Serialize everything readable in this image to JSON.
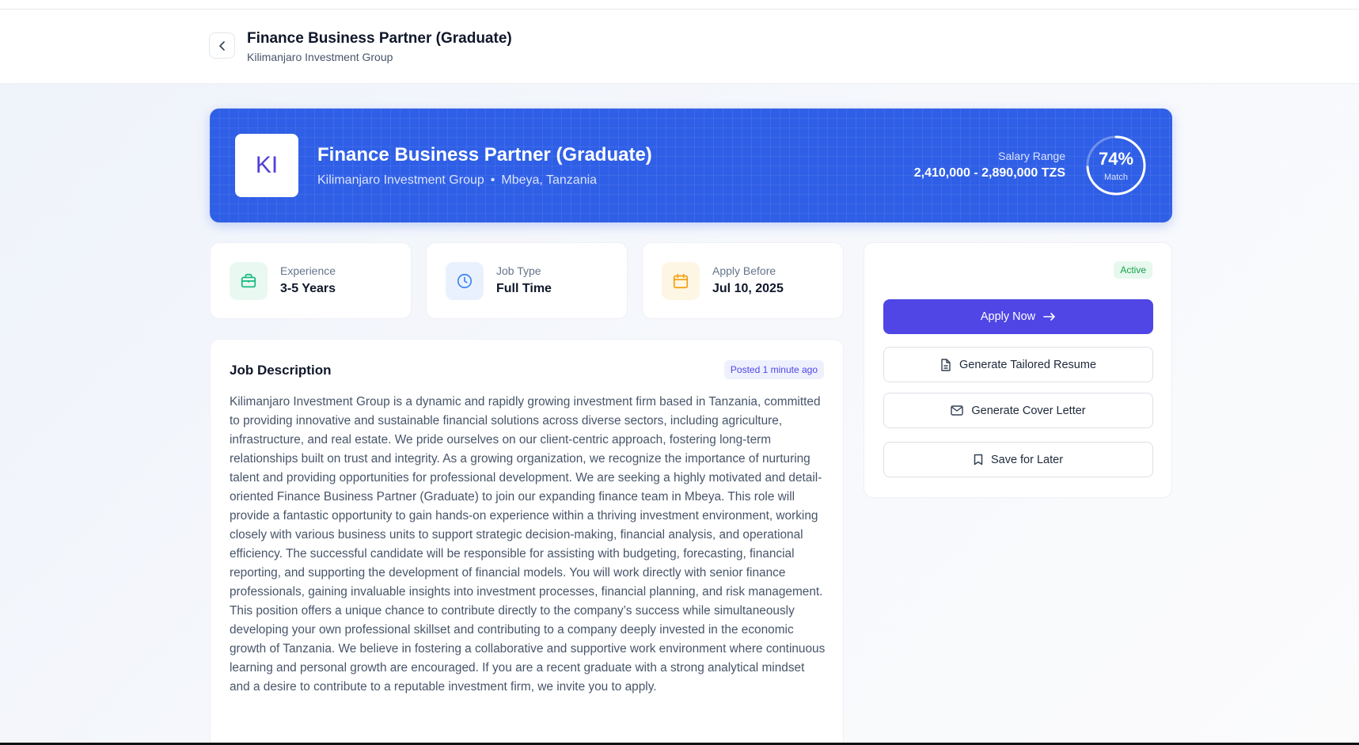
{
  "header": {
    "title": "Finance Business Partner (Graduate)",
    "subtitle": "Kilimanjaro Investment Group"
  },
  "hero": {
    "logo_text": "KI",
    "title": "Finance Business Partner (Graduate)",
    "company": "Kilimanjaro Investment Group",
    "separator": "•",
    "location": "Mbeya, Tanzania",
    "salary_label": "Salary Range",
    "salary_value": "2,410,000 - 2,890,000 TZS",
    "match_percent": "74%",
    "match_fraction": 0.74,
    "match_label": "Match"
  },
  "stats": [
    {
      "label": "Experience",
      "value": "3-5 Years",
      "icon": "briefcase-icon",
      "color": "#10b981"
    },
    {
      "label": "Job Type",
      "value": "Full Time",
      "icon": "clock-icon",
      "color": "#3b82f6"
    },
    {
      "label": "Apply Before",
      "value": "Jul 10, 2025",
      "icon": "calendar-icon",
      "color": "#f59e0b"
    }
  ],
  "description": {
    "title": "Job Description",
    "posted": "Posted 1 minute ago",
    "body": "Kilimanjaro Investment Group is a dynamic and rapidly growing investment firm based in Tanzania, committed to providing innovative and sustainable financial solutions across diverse sectors, including agriculture, infrastructure, and real estate. We pride ourselves on our client-centric approach, fostering long-term relationships built on trust and integrity. As a growing organization, we recognize the importance of nurturing talent and providing opportunities for professional development. We are seeking a highly motivated and detail-oriented Finance Business Partner (Graduate) to join our expanding finance team in Mbeya. This role will provide a fantastic opportunity to gain hands-on experience within a thriving investment environment, working closely with various business units to support strategic decision-making, financial analysis, and operational efficiency. The successful candidate will be responsible for assisting with budgeting, forecasting, financial reporting, and supporting the development of financial models. You will work directly with senior finance professionals, gaining invaluable insights into investment processes, financial planning, and risk management. This position offers a unique chance to contribute directly to the company’s success while simultaneously developing your own professional skillset and contributing to a company deeply invested in the economic growth of Tanzania. We believe in fostering a collaborative and supportive work environment where continuous learning and personal growth are encouraged. If you are a recent graduate with a strong analytical mindset and a desire to contribute to a reputable investment firm, we invite you to apply."
  },
  "sidebar": {
    "status": "Active",
    "apply_label": "Apply Now",
    "resume_label": "Generate Tailored Resume",
    "cover_label": "Generate Cover Letter",
    "save_label": "Save for Later"
  },
  "colors": {
    "hero_blue": "#2f5fe6",
    "primary": "#4f46e5",
    "active_green": "#16a34a"
  }
}
